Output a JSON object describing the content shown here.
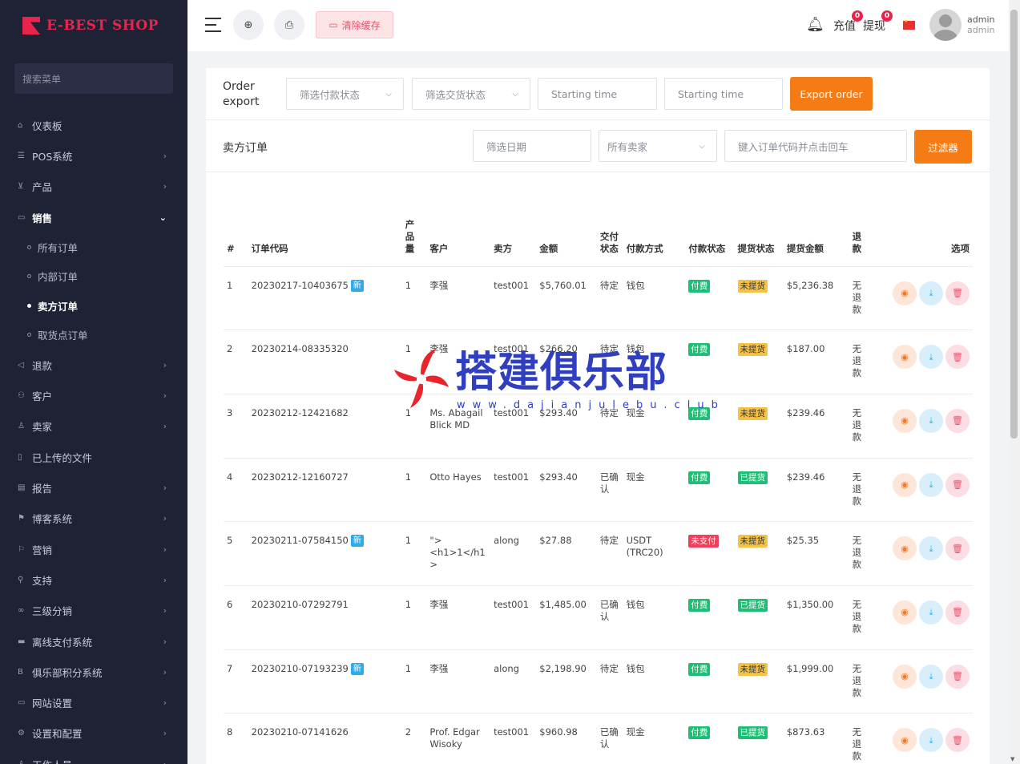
{
  "app": {
    "logo_text": "E-BEST SHOP"
  },
  "sidebar": {
    "search_placeholder": "搜索菜单",
    "items": [
      {
        "label": "仪表板",
        "icon": "home-icon",
        "arrow": ""
      },
      {
        "label": "POS系统",
        "icon": "list-icon",
        "arrow": "›"
      },
      {
        "label": "产品",
        "icon": "cart-icon",
        "arrow": "›"
      },
      {
        "label": "销售",
        "icon": "monitor-icon",
        "arrow": "⌄",
        "open": true
      },
      {
        "label": "退款",
        "icon": "refund-icon",
        "arrow": "›"
      },
      {
        "label": "客户",
        "icon": "users-icon",
        "arrow": "›"
      },
      {
        "label": "卖家",
        "icon": "user-icon",
        "arrow": "›"
      },
      {
        "label": "已上传的文件",
        "icon": "file-icon",
        "arrow": ""
      },
      {
        "label": "报告",
        "icon": "report-icon",
        "arrow": "›"
      },
      {
        "label": "博客系统",
        "icon": "blog-icon",
        "arrow": "›"
      },
      {
        "label": "营销",
        "icon": "marketing-icon",
        "arrow": "›"
      },
      {
        "label": "支持",
        "icon": "support-icon",
        "arrow": "›"
      },
      {
        "label": "三级分销",
        "icon": "link-icon",
        "arrow": "›"
      },
      {
        "label": "离线支付系统",
        "icon": "card-icon",
        "arrow": "›"
      },
      {
        "label": "俱乐部积分系统",
        "icon": "points-icon",
        "arrow": "›"
      },
      {
        "label": "网站设置",
        "icon": "desktop-icon",
        "arrow": "›"
      },
      {
        "label": "设置和配置",
        "icon": "settings-icon",
        "arrow": "›"
      },
      {
        "label": "工作人员",
        "icon": "staff-icon",
        "arrow": "›"
      }
    ],
    "sales_submenu": [
      {
        "label": "所有订单",
        "active": false
      },
      {
        "label": "内部订单",
        "active": false
      },
      {
        "label": "卖方订单",
        "active": true
      },
      {
        "label": "取货点订单",
        "active": false
      }
    ]
  },
  "header": {
    "clear_cache": "清除缓存",
    "recharge": "充值",
    "recharge_count": "0",
    "withdraw": "提现",
    "withdraw_count": "0",
    "admin_name": "admin",
    "admin_role": "admin"
  },
  "export_section": {
    "title": "Order export",
    "payment_status_placeholder": "筛选付款状态",
    "delivery_status_placeholder": "筛选交货状态",
    "start_time_1": "Starting time",
    "start_time_2": "Starting time",
    "export_button": "Export order"
  },
  "filter_section": {
    "title": "卖方订单",
    "date_placeholder": "筛选日期",
    "seller_select": "所有卖家",
    "search_placeholder": "键入订单代码并点击回车",
    "filter_button": "过滤器"
  },
  "table": {
    "headers": [
      "#",
      "订单代码",
      "产品量",
      "客户",
      "卖方",
      "金额",
      "交付状态",
      "付款方式",
      "付款状态",
      "提货状态",
      "提货金额",
      "退款",
      "选项"
    ],
    "rows": [
      {
        "no": "1",
        "code": "20230217-10403675",
        "is_new": true,
        "qty": "1",
        "customer": "李强",
        "seller": "test001",
        "amount": "$5,760.01",
        "delivery": "待定",
        "method": "钱包",
        "pay": "付费",
        "pay_ok": true,
        "pickup": "未提货",
        "pickup_ok": false,
        "pickup_amount": "$5,236.38",
        "refund": "无退款"
      },
      {
        "no": "2",
        "code": "20230214-08335320",
        "is_new": false,
        "qty": "1",
        "customer": "李强",
        "seller": "test001",
        "amount": "$266.20",
        "delivery": "待定",
        "method": "钱包",
        "pay": "付费",
        "pay_ok": true,
        "pickup": "未提货",
        "pickup_ok": false,
        "pickup_amount": "$187.00",
        "refund": "无退款"
      },
      {
        "no": "3",
        "code": "20230212-12421682",
        "is_new": false,
        "qty": "1",
        "customer": "Ms. Abagail Blick MD",
        "seller": "test001",
        "amount": "$293.40",
        "delivery": "待定",
        "method": "现金",
        "pay": "付费",
        "pay_ok": true,
        "pickup": "未提货",
        "pickup_ok": false,
        "pickup_amount": "$239.46",
        "refund": "无退款"
      },
      {
        "no": "4",
        "code": "20230212-12160727",
        "is_new": false,
        "qty": "1",
        "customer": "Otto Hayes",
        "seller": "test001",
        "amount": "$293.40",
        "delivery": "已确认",
        "method": "现金",
        "pay": "付费",
        "pay_ok": true,
        "pickup": "已提货",
        "pickup_ok": true,
        "pickup_amount": "$239.46",
        "refund": "无退款"
      },
      {
        "no": "5",
        "code": "20230211-07584150",
        "is_new": true,
        "qty": "1",
        "customer": "\"> <h1>1</h1>",
        "seller": "along",
        "amount": "$27.88",
        "delivery": "待定",
        "method": "USDT (TRC20)",
        "pay": "未支付",
        "pay_ok": false,
        "pickup": "未提货",
        "pickup_ok": false,
        "pickup_amount": "$25.35",
        "refund": "无退款"
      },
      {
        "no": "6",
        "code": "20230210-07292791",
        "is_new": false,
        "qty": "1",
        "customer": "李强",
        "seller": "test001",
        "amount": "$1,485.00",
        "delivery": "已确认",
        "method": "钱包",
        "pay": "付费",
        "pay_ok": true,
        "pickup": "已提货",
        "pickup_ok": true,
        "pickup_amount": "$1,350.00",
        "refund": "无退款"
      },
      {
        "no": "7",
        "code": "20230210-07193239",
        "is_new": true,
        "qty": "1",
        "customer": "李强",
        "seller": "along",
        "amount": "$2,198.90",
        "delivery": "待定",
        "method": "钱包",
        "pay": "付费",
        "pay_ok": true,
        "pickup": "未提货",
        "pickup_ok": false,
        "pickup_amount": "$1,999.00",
        "refund": "无退款"
      },
      {
        "no": "8",
        "code": "20230210-07141626",
        "is_new": false,
        "qty": "2",
        "customer": "Prof. Edgar Wisoky",
        "seller": "test001",
        "amount": "$960.98",
        "delivery": "已确认",
        "method": "现金",
        "pay": "付费",
        "pay_ok": true,
        "pickup": "已提货",
        "pickup_ok": true,
        "pickup_amount": "$873.63",
        "refund": "无退款"
      }
    ],
    "new_label": "新"
  },
  "watermark": {
    "text": "搭建俱乐部",
    "url": "www.dajianjulebu.club"
  },
  "colors": {
    "sidebar_bg": "#1f2235",
    "accent_orange": "#f57c15",
    "paid_green": "#1cbf73",
    "unpaid_red": "#ef3f5a",
    "pending_yellow": "#f6c243",
    "new_blue": "#2eabe8"
  }
}
